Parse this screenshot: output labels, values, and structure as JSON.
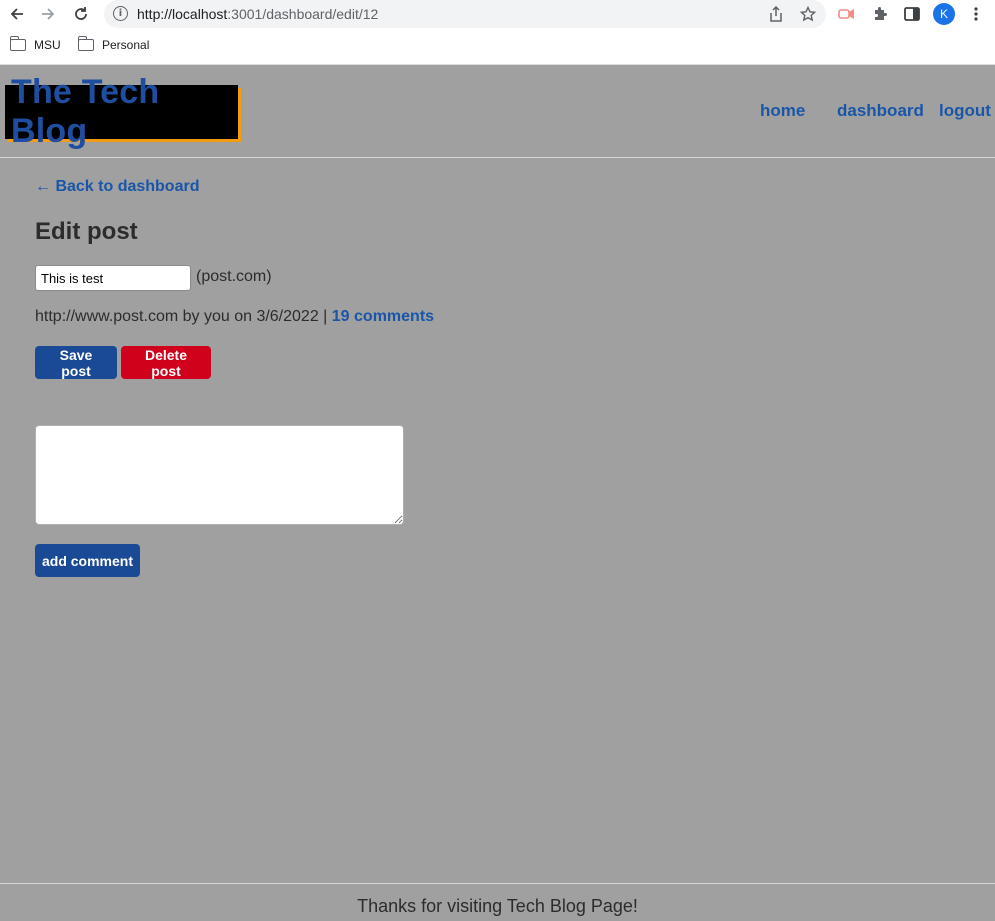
{
  "browser": {
    "url_host": "http://localhost",
    "url_path": ":3001/dashboard/edit/12",
    "profile_initial": "K",
    "bookmarks": [
      {
        "label": "MSU"
      },
      {
        "label": "Personal"
      }
    ]
  },
  "site": {
    "logo_text": "The Tech Blog",
    "nav": {
      "home": "home",
      "dashboard": "dashboard",
      "logout": "logout"
    }
  },
  "main": {
    "back_link": "← Back to dashboard",
    "heading": "Edit post",
    "title_value": "This is test",
    "domain": "(post.com)",
    "meta_text": "http://www.post.com by you on 3/6/2022 |",
    "comments_link": "19 comments",
    "save_label": "Save post",
    "delete_label": "Delete post",
    "comment_value": "",
    "add_comment_label": "add comment"
  },
  "footer": {
    "text": "Thanks for visiting Tech Blog Page!"
  },
  "colors": {
    "page_bg": "#a0a0a0",
    "link": "#1a56a8",
    "primary_button": "#1a4a96",
    "danger_button": "#d0021b",
    "logo_accent": "#f39c12"
  }
}
